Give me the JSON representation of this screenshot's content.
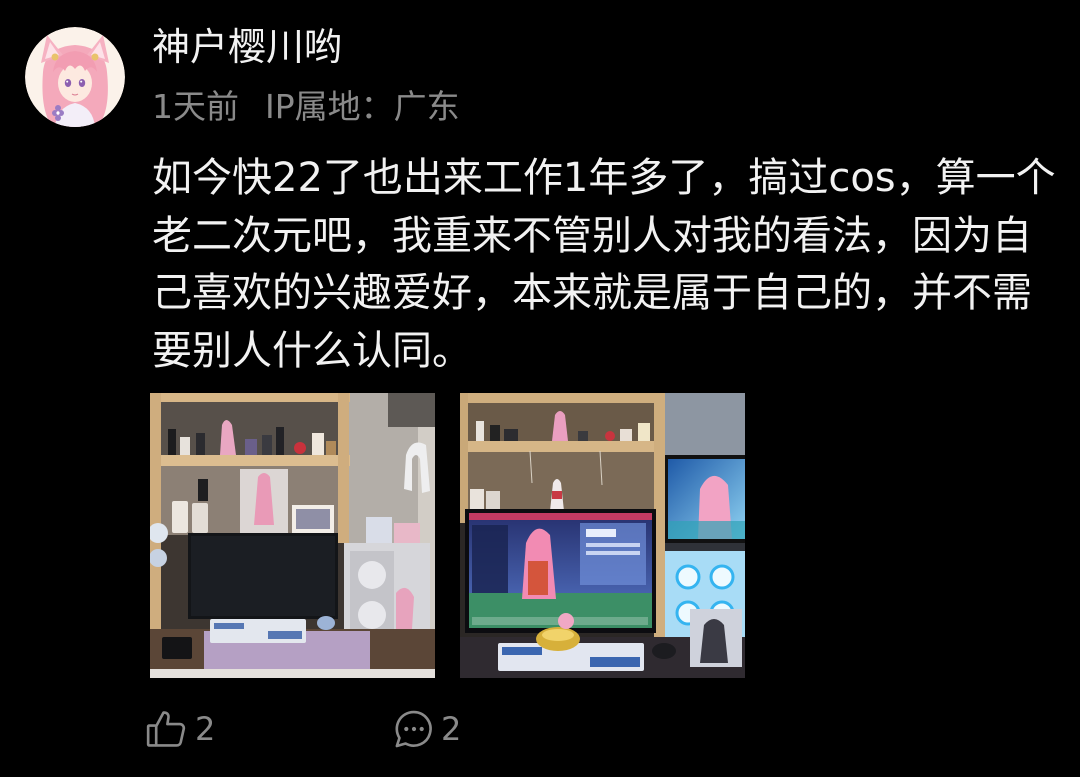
{
  "colors": {
    "background": "#000000",
    "text_primary": "#f2f2f2",
    "text_secondary": "#8a8a8a"
  },
  "comment": {
    "username": "神户樱川哟",
    "time": "1天前",
    "ip_location": "IP属地：广东",
    "content_lines": [
      "如今快22了也出来工作1年多了，搞过cos，算一个",
      "老二次元吧，我重来不管别人对我的看法，因为自",
      "己喜欢的兴趣爱好，本来就是属于自己的，并不需",
      "要别人什么认同。"
    ]
  },
  "actions": {
    "like_icon": "thumbs-up-icon",
    "like_count": "2",
    "comment_icon": "comment-icon",
    "comment_count": "2"
  }
}
